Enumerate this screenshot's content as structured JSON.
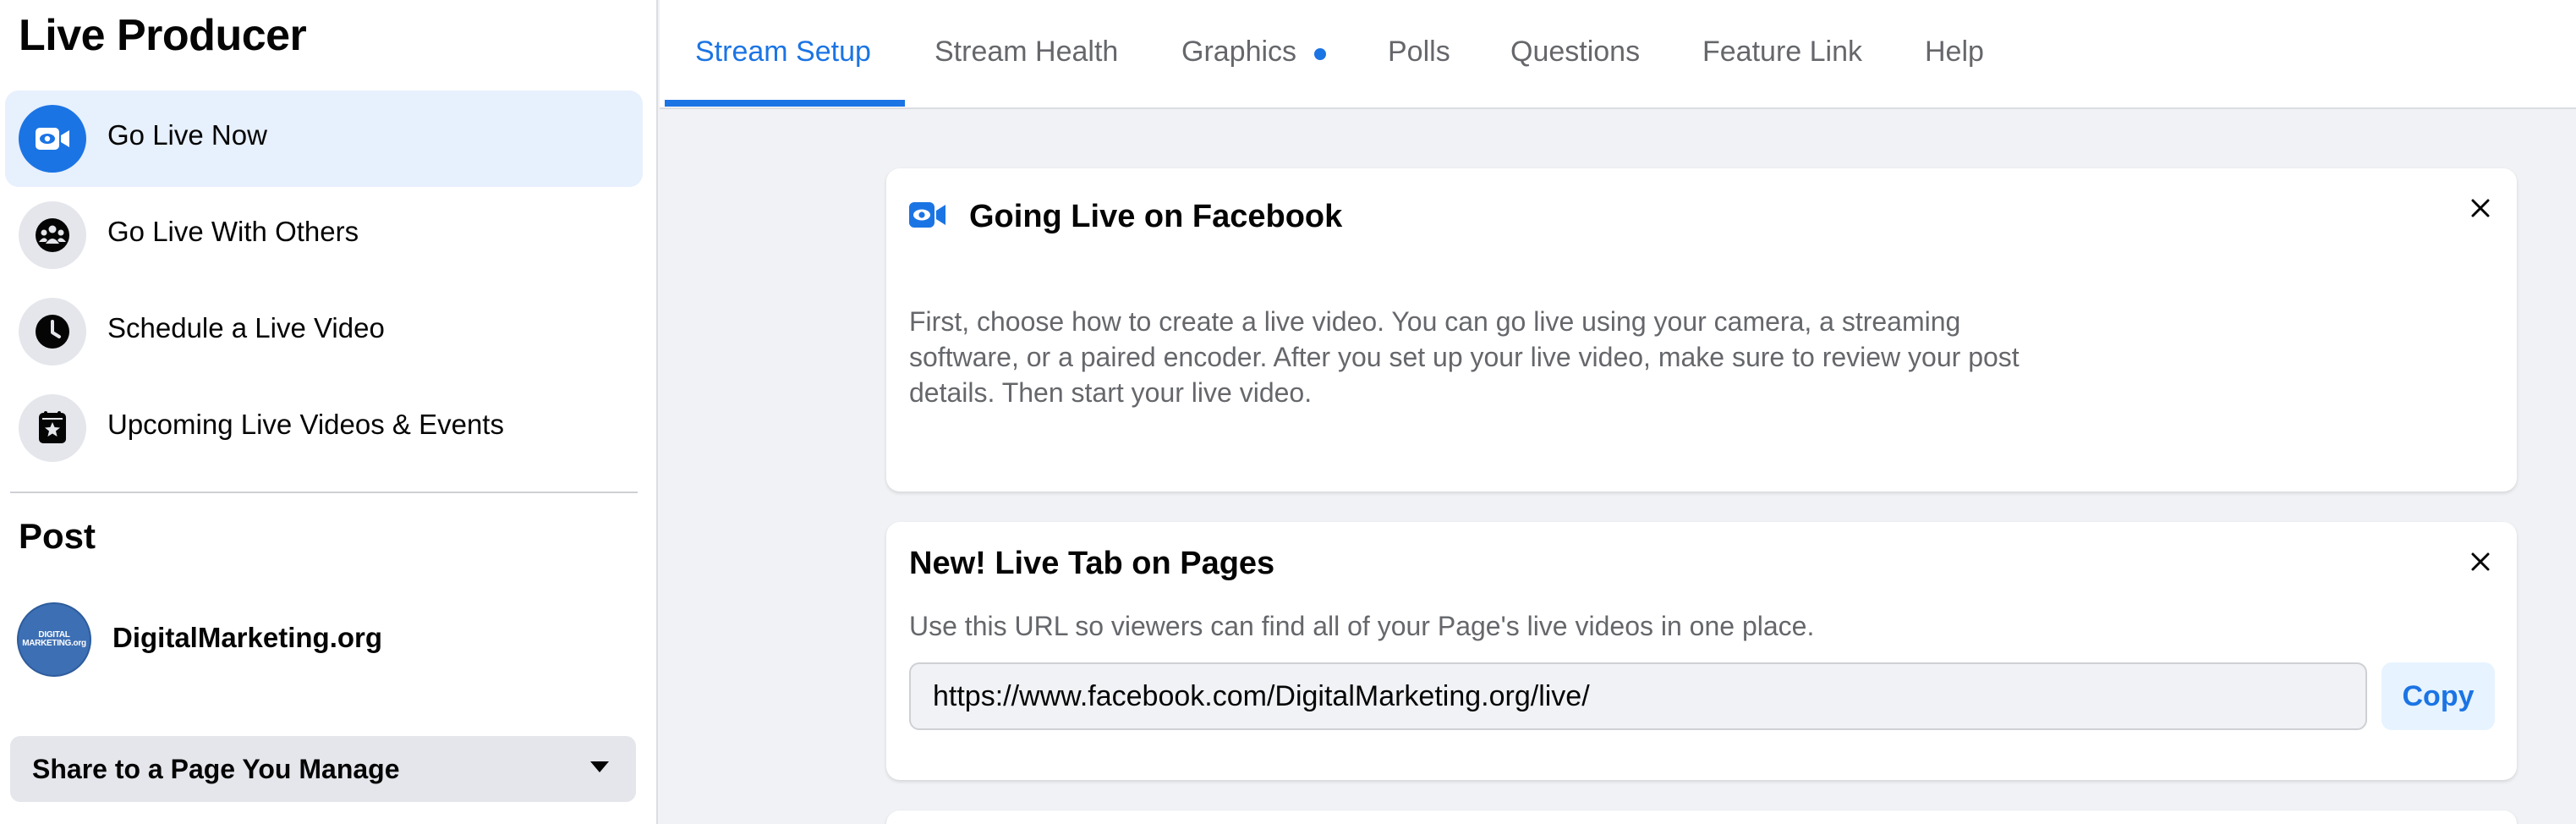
{
  "app": {
    "title": "Live Producer"
  },
  "sidebar": {
    "items": [
      {
        "label": "Go Live Now",
        "icon": "video-camera-icon",
        "active": true
      },
      {
        "label": "Go Live With Others",
        "icon": "group-icon",
        "active": false
      },
      {
        "label": "Schedule a Live Video",
        "icon": "clock-icon",
        "active": false
      },
      {
        "label": "Upcoming Live Videos & Events",
        "icon": "calendar-star-icon",
        "active": false
      }
    ],
    "post_section_title": "Post",
    "post_page": {
      "name": "DigitalMarketing.org",
      "avatar_text_line1": "DIGITAL",
      "avatar_text_line2": "MARKETING.org"
    },
    "share_select": {
      "selected": "Share to a Page You Manage"
    }
  },
  "tabs": [
    {
      "label": "Stream Setup",
      "active": true
    },
    {
      "label": "Stream Health",
      "active": false
    },
    {
      "label": "Graphics",
      "active": false,
      "has_dot": true
    },
    {
      "label": "Polls",
      "active": false
    },
    {
      "label": "Questions",
      "active": false
    },
    {
      "label": "Feature Link",
      "active": false
    },
    {
      "label": "Help",
      "active": false
    }
  ],
  "cards": {
    "going_live": {
      "title": "Going Live on Facebook",
      "body": "First, choose how to create a live video. You can go live using your camera, a streaming software, or a paired encoder. After you set up your live video, make sure to review your post details. Then start your live video."
    },
    "live_tab": {
      "title": "New! Live Tab on Pages",
      "body": "Use this URL so viewers can find all of your Page's live videos in one place.",
      "url": "https://www.facebook.com/DigitalMarketing.org/live/",
      "copy_label": "Copy"
    }
  },
  "colors": {
    "accent": "#1b74e4",
    "background": "#f0f2f5",
    "active_nav_bg": "#e7f0fd",
    "secondary_text": "#65676b"
  }
}
